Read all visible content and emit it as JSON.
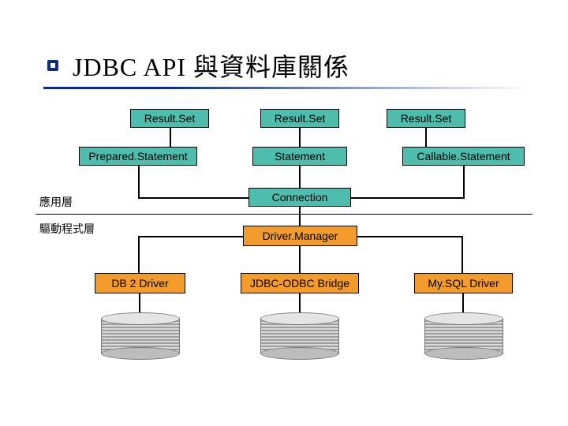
{
  "title": "JDBC API 與資料庫關係",
  "labels": {
    "app_layer": "應用層",
    "driver_layer": "驅動程式層"
  },
  "boxes": {
    "rs1": "Result.Set",
    "rs2": "Result.Set",
    "rs3": "Result.Set",
    "prepared": "Prepared.Statement",
    "statement": "Statement",
    "callable": "Callable.Statement",
    "connection": "Connection",
    "driver_manager": "Driver.Manager",
    "db2": "DB 2 Driver",
    "odbc": "JDBC-ODBC Bridge",
    "mysql": "My.SQL Driver"
  }
}
